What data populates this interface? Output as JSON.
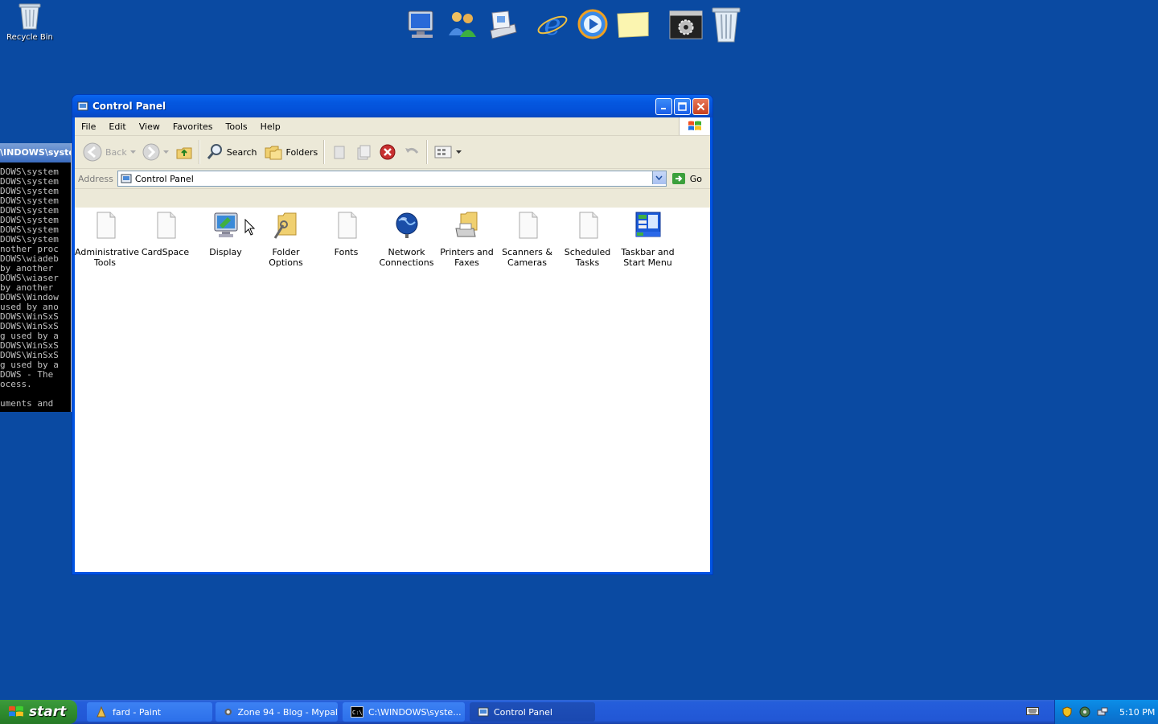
{
  "desktop": {
    "recycle_bin_label": "Recycle Bin"
  },
  "quick_launch": [
    {
      "icon": "my-computer-icon"
    },
    {
      "icon": "users-icon"
    },
    {
      "icon": "scanner-icon"
    },
    {
      "icon": "internet-explorer-icon"
    },
    {
      "icon": "media-player-icon"
    },
    {
      "icon": "sticky-note-icon"
    },
    {
      "icon": "settings-icon"
    },
    {
      "icon": "recycle-bin-icon"
    }
  ],
  "console": {
    "title": "\\INDOWS\\syste",
    "lines": "DOWS\\system\nDOWS\\system\nDOWS\\system\nDOWS\\system\nDOWS\\system\nDOWS\\system\nDOWS\\system\nDOWS\\system\nnother proc\nDOWS\\wiadeb\nby another \nDOWS\\wiaser\nby another \nDOWS\\Window\nused by ano\nDOWS\\WinSxS\nDOWS\\WinSxS\ng used by a\nDOWS\\WinSxS\nDOWS\\WinSxS\ng used by a\nDOWS - The \nocess.\n\numents and "
  },
  "window": {
    "title": "Control Panel",
    "menu": [
      "File",
      "Edit",
      "View",
      "Favorites",
      "Tools",
      "Help"
    ],
    "toolbar": {
      "back_label": "Back",
      "search_label": "Search",
      "folders_label": "Folders"
    },
    "address": {
      "label": "Address",
      "value": "Control Panel",
      "go_label": "Go"
    },
    "items": [
      {
        "label": "Administrative Tools",
        "icon": "administrative-tools-icon"
      },
      {
        "label": "CardSpace",
        "icon": "cardspace-icon"
      },
      {
        "label": "Display",
        "icon": "display-icon"
      },
      {
        "label": "Folder Options",
        "icon": "folder-options-icon"
      },
      {
        "label": "Fonts",
        "icon": "fonts-icon"
      },
      {
        "label": "Network Connections",
        "icon": "network-connections-icon"
      },
      {
        "label": "Printers and Faxes",
        "icon": "printers-faxes-icon"
      },
      {
        "label": "Scanners & Cameras",
        "icon": "scanners-cameras-icon"
      },
      {
        "label": "Scheduled Tasks",
        "icon": "scheduled-tasks-icon"
      },
      {
        "label": "Taskbar and Start Menu",
        "icon": "taskbar-start-menu-icon"
      }
    ]
  },
  "taskbar": {
    "start_label": "start",
    "tasks": [
      {
        "label": "fard - Paint",
        "active": false
      },
      {
        "label": "Zone 94 - Blog - Mypal",
        "active": false
      },
      {
        "label": "C:\\WINDOWS\\syste...",
        "active": false
      },
      {
        "label": "Control Panel",
        "active": true
      }
    ],
    "clock": "5:10 PM"
  }
}
